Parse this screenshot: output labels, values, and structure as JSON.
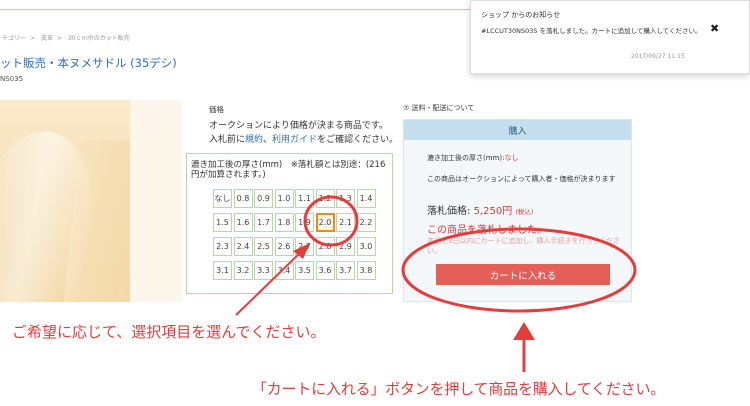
{
  "breadcrumb": [
    "テゴリー",
    "皮革",
    "30ｃｍ巾のカット販売"
  ],
  "product": {
    "title": "ット販売・本ヌメサドル (35デシ)",
    "code": "NS035"
  },
  "price_info": {
    "label": "価格",
    "desc1": "オークションにより価格が決まる商品です。",
    "desc2_prefix": "入札前に",
    "link_terms": "規約",
    "sep": "、",
    "link_guide": "利用ガイド",
    "desc2_suffix": "をご確認ください。"
  },
  "thickness_select": {
    "heading": "漉き加工後の厚さ(mm)　※落札額とは別途：(216円が加算されます。)",
    "options": [
      "なし",
      "0.8",
      "0.9",
      "1.0",
      "1.1",
      "1.2",
      "1.3",
      "1.4",
      "1.5",
      "1.6",
      "1.7",
      "1.8",
      "1.9",
      "2.0",
      "2.1",
      "2.2",
      "2.3",
      "2.4",
      "2.5",
      "2.6",
      "2.7",
      "2.8",
      "2.9",
      "3.0",
      "3.1",
      "3.2",
      "3.3",
      "3.4",
      "3.5",
      "3.6",
      "3.7",
      "3.8"
    ],
    "selected": "2.0"
  },
  "shipping_link": "送料・配送について",
  "buy_panel": {
    "header": "購入",
    "thickness_label": "漉き加工後の厚さ(mm):",
    "thickness_value": "なし",
    "auction_note": "この商品はオークションによって購入者・価格が決まります",
    "winning_label": "落札価格: ",
    "winning_amount": "5,250円",
    "tax_note": "(税込)",
    "won_message": "この商品を落札しました。",
    "faded_note": "本品を3日以内にカートに追加し、購入手続きを行ってください。",
    "cart_button": "カートに入れる"
  },
  "notice": {
    "title": "ショップ からのお知らせ",
    "body": "#LCCUT30NS035 を落札しました。カートに追加して購入してください。",
    "timestamp": "2017/09/27 11:15",
    "close": "✖"
  },
  "annotations": {
    "caption_select": "ご希望に応じて、選択項目を選んでください。",
    "caption_cart": "「カートに入れる」ボタンを押して商品を購入してください。",
    "color": "#e53c3c"
  }
}
